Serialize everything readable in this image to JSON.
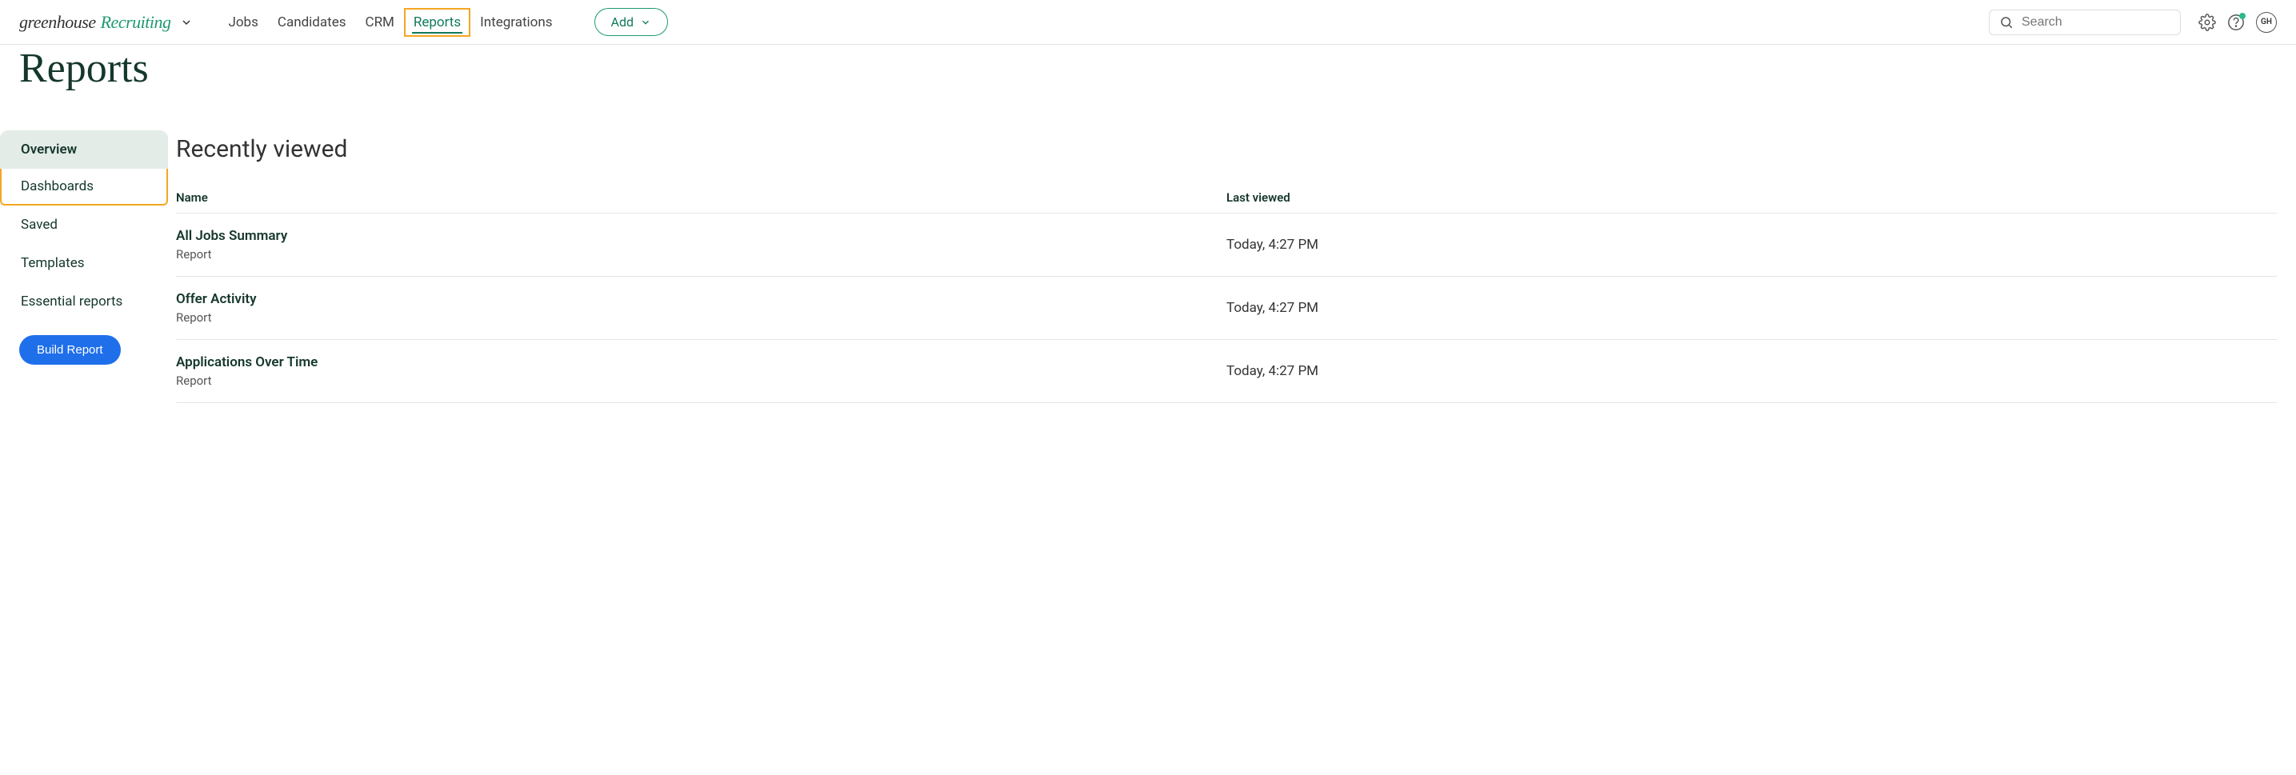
{
  "brand": {
    "part1": "greenhouse",
    "part2": "Recruiting"
  },
  "nav": {
    "items": [
      {
        "label": "Jobs",
        "active": false
      },
      {
        "label": "Candidates",
        "active": false
      },
      {
        "label": "CRM",
        "active": false
      },
      {
        "label": "Reports",
        "active": true
      },
      {
        "label": "Integrations",
        "active": false
      }
    ],
    "add_label": "Add"
  },
  "search": {
    "placeholder": "Search"
  },
  "avatar": {
    "initials": "GH"
  },
  "page": {
    "title": "Reports"
  },
  "sidebar": {
    "items": [
      {
        "label": "Overview",
        "selected": true,
        "highlighted": false
      },
      {
        "label": "Dashboards",
        "selected": false,
        "highlighted": true
      },
      {
        "label": "Saved",
        "selected": false,
        "highlighted": false
      },
      {
        "label": "Templates",
        "selected": false,
        "highlighted": false
      },
      {
        "label": "Essential reports",
        "selected": false,
        "highlighted": false
      }
    ],
    "build_label": "Build Report"
  },
  "section": {
    "title": "Recently viewed",
    "columns": {
      "name": "Name",
      "last": "Last viewed"
    },
    "rows": [
      {
        "title": "All Jobs Summary",
        "sub": "Report",
        "last": "Today, 4:27 PM"
      },
      {
        "title": "Offer Activity",
        "sub": "Report",
        "last": "Today, 4:27 PM"
      },
      {
        "title": "Applications Over Time",
        "sub": "Report",
        "last": "Today, 4:27 PM"
      }
    ]
  }
}
